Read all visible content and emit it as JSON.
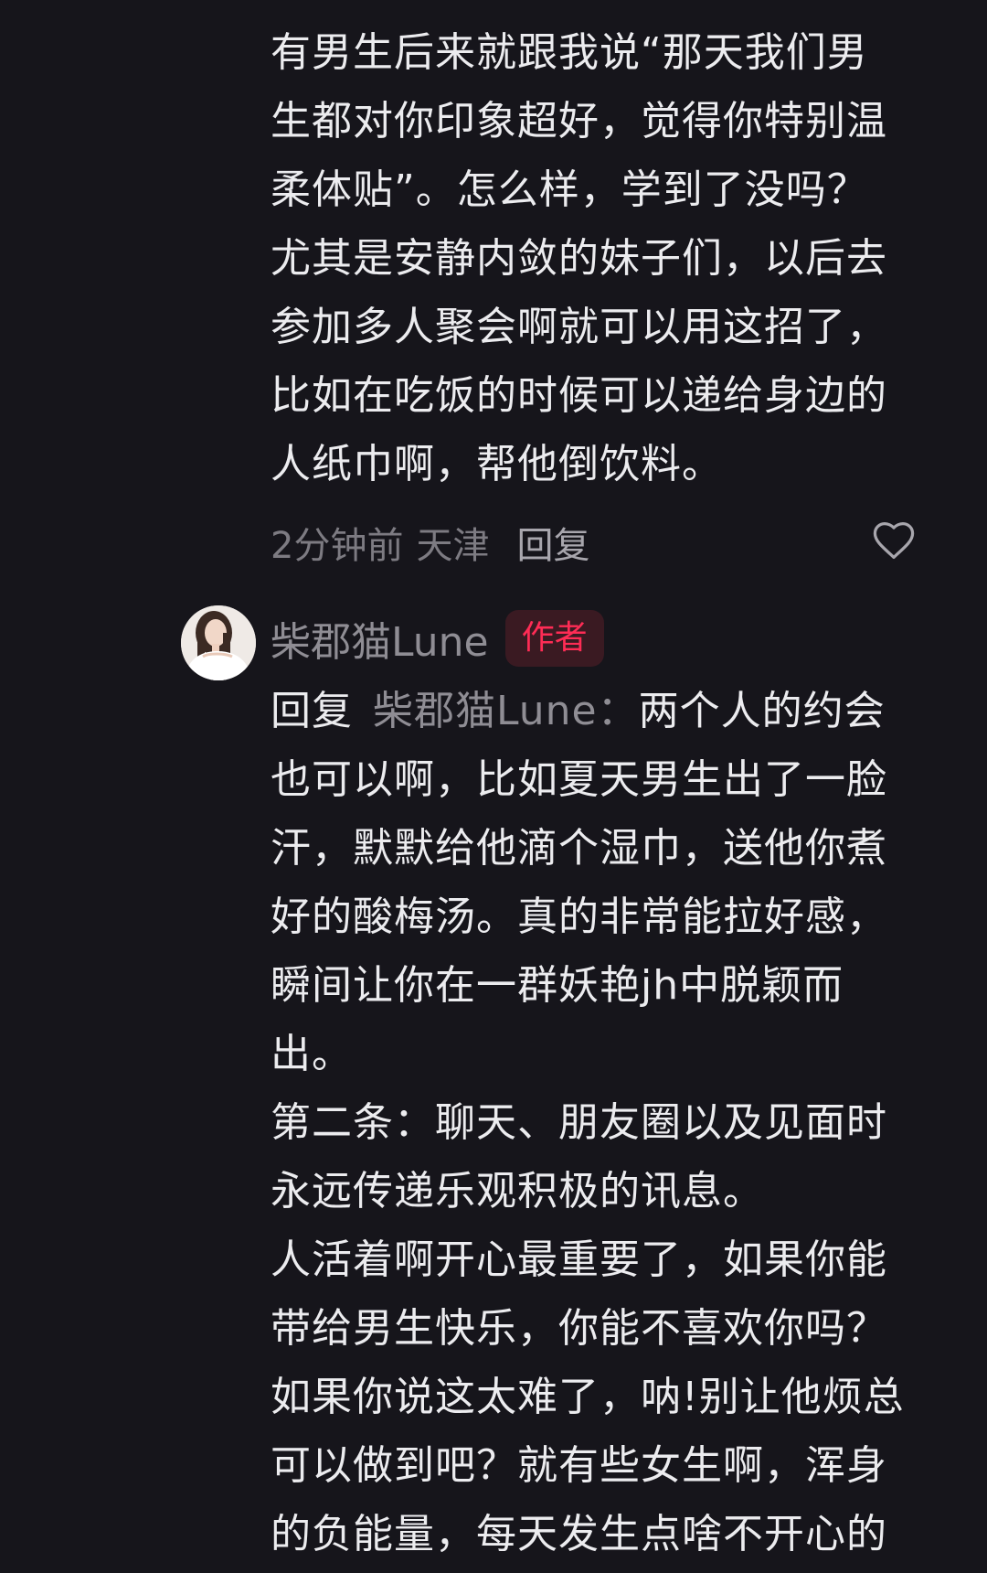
{
  "first_comment": {
    "lines": [
      "有男生后来就跟我说“那天我们男",
      "生都对你印象超好，觉得你特别温",
      "柔体贴”。怎么样，学到了没吗？",
      "尤其是安静内敛的妹子们，以后去",
      "参加多人聚会啊就可以用这招了，",
      "比如在吃饭的时候可以递给身边的",
      "人纸巾啊，帮他倒饮料。"
    ],
    "time": "2分钟前",
    "location": "天津",
    "reply_label": "回复",
    "like_icon": "heart-outline-icon"
  },
  "reply_comment": {
    "avatar_icon": "user-avatar-photo",
    "author": "柴郡猫Lune",
    "badge": "作者",
    "reply_prefix": "回复",
    "reply_target": "柴郡猫Lune：",
    "first_line_rest": "两个人的约会",
    "lines": [
      "也可以啊，比如夏天男生出了一脸",
      "汗，默默给他滴个湿巾，送他你煮",
      "好的酸梅汤。真的非常能拉好感，",
      "瞬间让你在一群妖艳jh中脱颖而",
      "出。",
      "第二条：聊天、朋友圈以及见面时",
      "永远传递乐观积极的讯息。",
      "人活着啊开心最重要了，如果你能",
      "带给男生快乐，你能不喜欢你吗？",
      "如果你说这太难了，呐!别让他烦总",
      "可以做到吧？就有些女生啊，浑身",
      "的负能量，每天发生点啥不开心的"
    ]
  },
  "colors": {
    "background": "#16151b",
    "text": "#ececef",
    "secondary_text": "#8f8d94",
    "meta_text": "#7d7b82",
    "badge_text": "#fe2c55",
    "badge_bg": "#3a1a22"
  }
}
